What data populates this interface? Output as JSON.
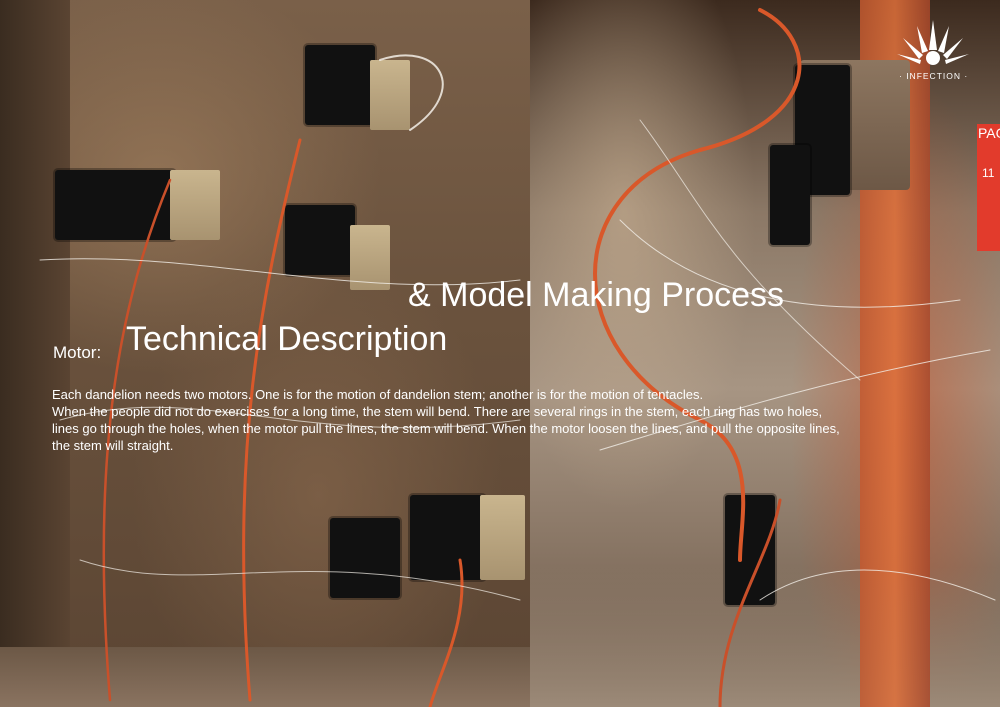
{
  "brand": {
    "logo_text": "· INFECTION ·",
    "accent_color": "#e23b2c"
  },
  "page": {
    "tab_label": "PAGE",
    "number": "11"
  },
  "title": {
    "line1": "& Model Making Process",
    "line2": "Technical Description"
  },
  "section_label": "Motor:",
  "body": {
    "paragraphs": [
      "Each dandelion needs two motors. One is for the motion of dandelion stem; another is for the motion of tentacles.",
      "When the people did not do exercises for a long time, the stem will bend. There are several rings in the stem, each ring has two holes,",
      "lines go through the holes, when the motor pull the lines, the stem will bend. When the motor loosen the lines, and pull the opposite lines,",
      "the stem will straight."
    ]
  }
}
